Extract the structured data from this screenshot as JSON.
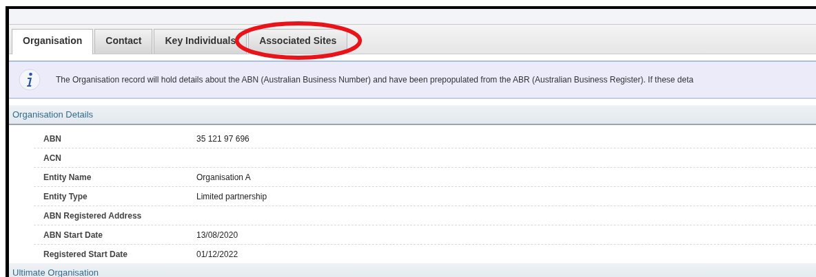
{
  "tabs": [
    {
      "label": "Organisation",
      "selected": true,
      "circled": false
    },
    {
      "label": "Contact",
      "selected": false,
      "circled": false
    },
    {
      "label": "Key Individuals",
      "selected": false,
      "circled": false
    },
    {
      "label": "Associated Sites",
      "selected": false,
      "circled": true
    }
  ],
  "info": {
    "text": "The Organisation record will hold details about the ABN (Australian Business Number) and have been prepopulated from the ABR (Australian Business Register). If these deta"
  },
  "sections": [
    {
      "title": "Organisation Details",
      "fields": [
        {
          "label": "ABN",
          "value": "35 121 97 696"
        },
        {
          "label": "ACN"
        },
        {
          "label": "Entity Name",
          "value": "Organisation A"
        },
        {
          "label": "Entity Type",
          "value": "Limited partnership"
        },
        {
          "label": "ABN Registered Address"
        },
        {
          "label": "ABN Start Date",
          "value": "13/08/2020"
        },
        {
          "label": "Registered Start Date",
          "value": "01/12/2022"
        }
      ]
    },
    {
      "title": "Ultimate Organisation"
    }
  ]
}
